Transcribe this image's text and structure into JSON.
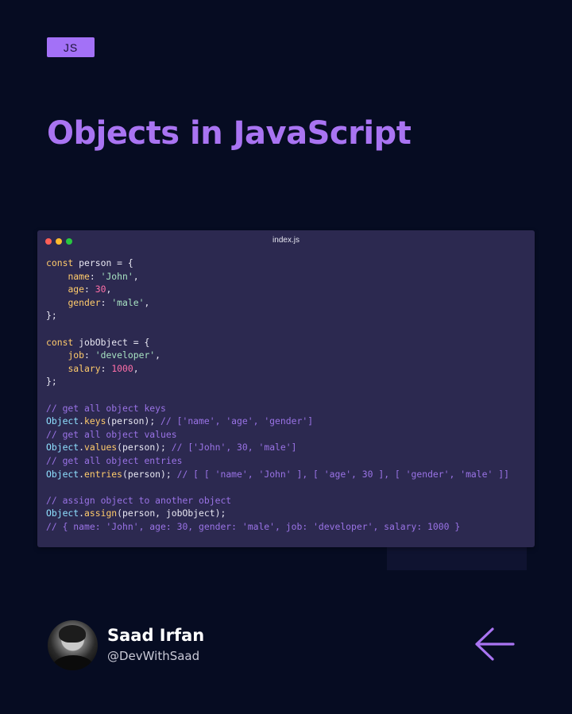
{
  "tag": "JS",
  "title": "Objects in JavaScript",
  "window": {
    "filename": "index.js",
    "code": [
      [
        [
          "kw",
          "const "
        ],
        [
          "var",
          "person"
        ],
        [
          "pun",
          " = {"
        ]
      ],
      [
        [
          "pun",
          "    "
        ],
        [
          "prop",
          "name"
        ],
        [
          "pun",
          ": "
        ],
        [
          "str",
          "'John'"
        ],
        [
          "pun",
          ","
        ]
      ],
      [
        [
          "pun",
          "    "
        ],
        [
          "prop",
          "age"
        ],
        [
          "pun",
          ": "
        ],
        [
          "num",
          "30"
        ],
        [
          "pun",
          ","
        ]
      ],
      [
        [
          "pun",
          "    "
        ],
        [
          "prop",
          "gender"
        ],
        [
          "pun",
          ": "
        ],
        [
          "str",
          "'male'"
        ],
        [
          "pun",
          ","
        ]
      ],
      [
        [
          "pun",
          "};"
        ]
      ],
      [],
      [
        [
          "kw",
          "const "
        ],
        [
          "var",
          "jobObject"
        ],
        [
          "pun",
          " = {"
        ]
      ],
      [
        [
          "pun",
          "    "
        ],
        [
          "prop",
          "job"
        ],
        [
          "pun",
          ": "
        ],
        [
          "str",
          "'developer'"
        ],
        [
          "pun",
          ","
        ]
      ],
      [
        [
          "pun",
          "    "
        ],
        [
          "prop",
          "salary"
        ],
        [
          "pun",
          ": "
        ],
        [
          "num",
          "1000"
        ],
        [
          "pun",
          ","
        ]
      ],
      [
        [
          "pun",
          "};"
        ]
      ],
      [],
      [
        [
          "cm",
          "// get all object keys"
        ]
      ],
      [
        [
          "obj",
          "Object"
        ],
        [
          "pun",
          "."
        ],
        [
          "fn",
          "keys"
        ],
        [
          "pun",
          "(person); "
        ],
        [
          "cm",
          "// ['name', 'age', 'gender']"
        ]
      ],
      [
        [
          "cm",
          "// get all object values"
        ]
      ],
      [
        [
          "obj",
          "Object"
        ],
        [
          "pun",
          "."
        ],
        [
          "fn",
          "values"
        ],
        [
          "pun",
          "(person); "
        ],
        [
          "cm",
          "// ['John', 30, 'male']"
        ]
      ],
      [
        [
          "cm",
          "// get all object entries"
        ]
      ],
      [
        [
          "obj",
          "Object"
        ],
        [
          "pun",
          "."
        ],
        [
          "fn",
          "entries"
        ],
        [
          "pun",
          "(person); "
        ],
        [
          "cm",
          "// [ [ 'name', 'John' ], [ 'age', 30 ], [ 'gender', 'male' ]]"
        ]
      ],
      [],
      [
        [
          "cm",
          "// assign object to another object"
        ]
      ],
      [
        [
          "obj",
          "Object"
        ],
        [
          "pun",
          "."
        ],
        [
          "fn",
          "assign"
        ],
        [
          "pun",
          "(person, jobObject);"
        ]
      ],
      [
        [
          "cm",
          "// { name: 'John', age: 30, gender: 'male', job: 'developer', salary: 1000 }"
        ]
      ]
    ]
  },
  "author": {
    "name": "Saad Irfan",
    "handle": "@DevWithSaad"
  },
  "icons": {
    "back": "arrow-left-icon"
  },
  "colors": {
    "background": "#060c22",
    "accent": "#a974f2",
    "window": "#2c2950"
  }
}
